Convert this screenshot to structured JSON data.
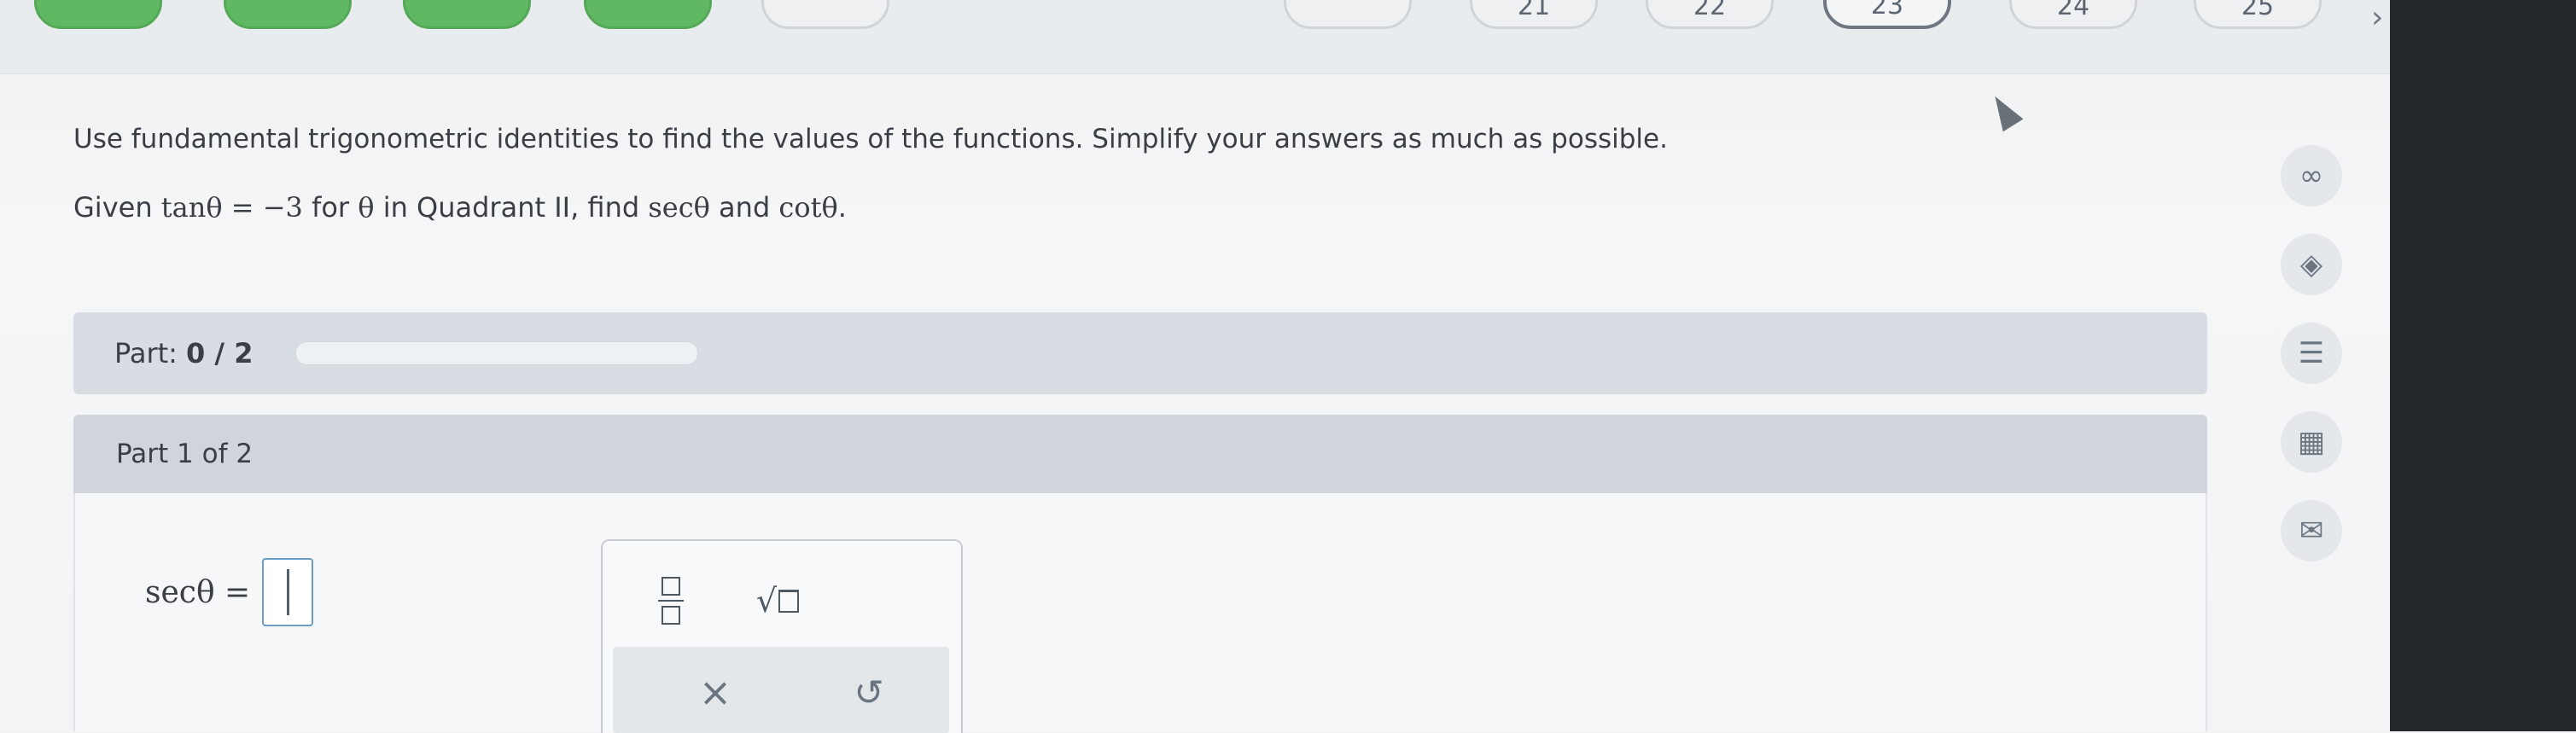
{
  "nav": {
    "questions": [
      {
        "label": "",
        "status": "done"
      },
      {
        "label": "",
        "status": "done"
      },
      {
        "label": "",
        "status": "done"
      },
      {
        "label": "",
        "status": "done"
      },
      {
        "label": "",
        "status": "unvisited"
      },
      {
        "label": "",
        "status": "unvisited"
      },
      {
        "label": "21",
        "status": "unvisited"
      },
      {
        "label": "22",
        "status": "unvisited"
      },
      {
        "label": "23",
        "status": "current"
      },
      {
        "label": "24",
        "status": "unvisited"
      },
      {
        "label": "25",
        "status": "unvisited"
      }
    ],
    "next_icon": "chevron-right-icon"
  },
  "question": {
    "instructions": "Use fundamental trigonometric identities to find the values of the functions. Simplify your answers as much as possible.",
    "given_prefix": "Given",
    "given_eq": "tanθ = −3",
    "given_mid1": "for",
    "given_var": "θ",
    "given_mid2": "in Quadrant II, find",
    "find1": "secθ",
    "find_and": "and",
    "find2": "cotθ",
    "find_end": "."
  },
  "progress": {
    "label": "Part:",
    "count": "0 / 2",
    "fraction": 0
  },
  "part": {
    "header": "Part 1 of 2",
    "lhs": "secθ =",
    "answer_value": ""
  },
  "palette": {
    "buttons": [
      "fraction-icon",
      "square-root-icon"
    ],
    "clear_label": "×",
    "undo_label": "↺"
  },
  "side_tools": [
    "infinity-icon",
    "tag-icon",
    "notes-icon",
    "calculator-icon",
    "mail-icon"
  ],
  "colors": {
    "done": "#5fb862",
    "accent": "#6a9ec8"
  }
}
